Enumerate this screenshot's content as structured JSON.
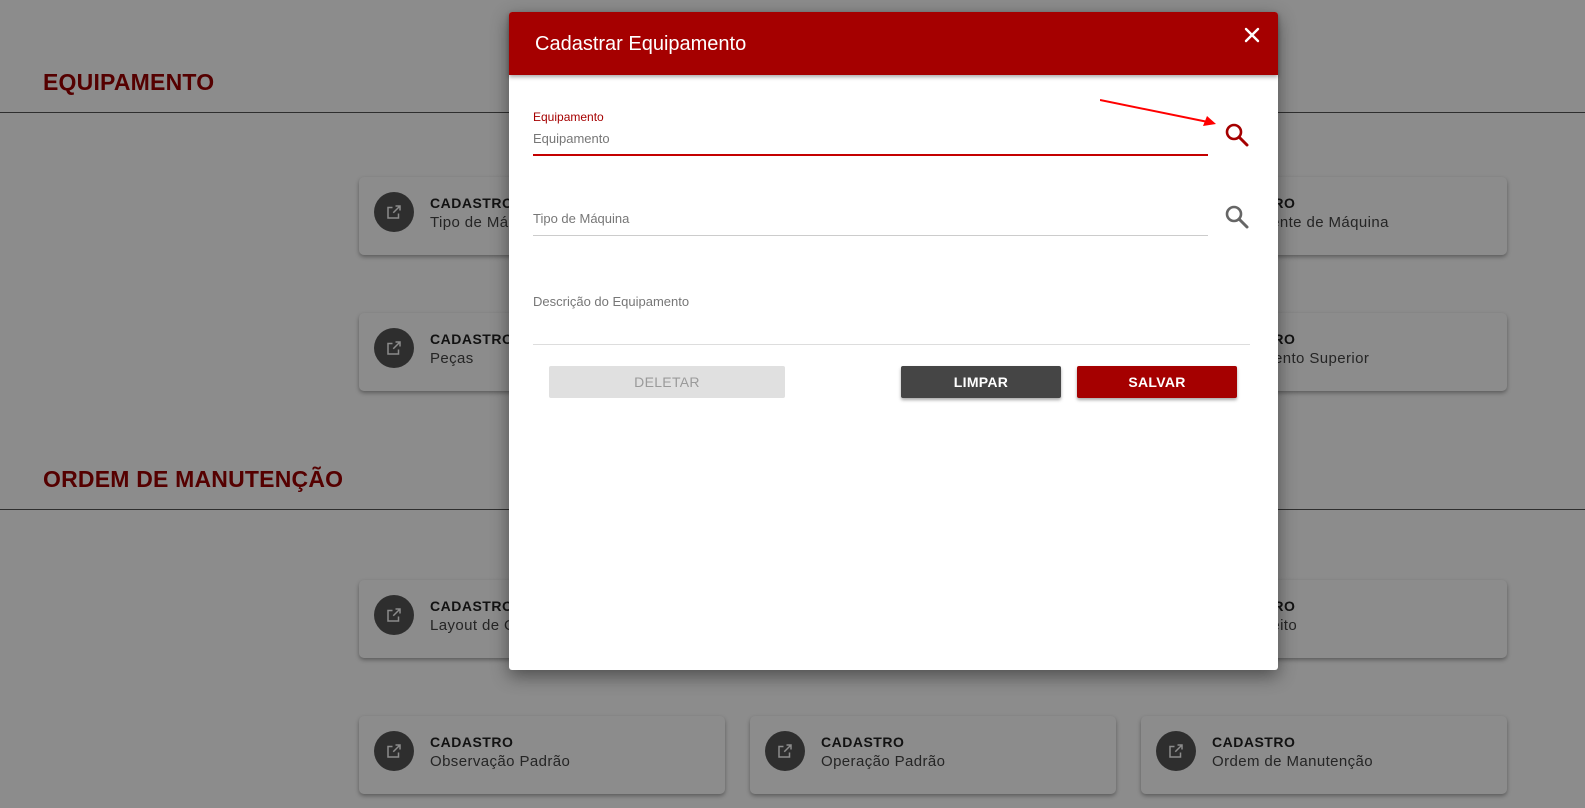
{
  "background": {
    "sections": [
      {
        "title": "EQUIPAMENTO"
      },
      {
        "title": "ORDEM DE MANUTENÇÃO"
      }
    ],
    "cards": [
      {
        "kind": "CADASTRO",
        "name": "Tipo de Máquina"
      },
      {
        "kind": "CADASTRO",
        "name": "Componente de Máquina"
      },
      {
        "kind": "CADASTRO",
        "name": "Peças"
      },
      {
        "kind": "CADASTRO",
        "name": "Equipamento Superior"
      },
      {
        "kind": "CADASTRO",
        "name": "Layout de Ordem"
      },
      {
        "kind": "CADASTRO",
        "name": "Tipo Defeito"
      },
      {
        "kind": "CADASTRO",
        "name": "Observação Padrão"
      },
      {
        "kind": "CADASTRO",
        "name": "Operação Padrão"
      },
      {
        "kind": "CADASTRO",
        "name": "Ordem de Manutenção"
      }
    ],
    "card_icon": "open-in-new-icon"
  },
  "modal": {
    "title": "Cadastrar Equipamento",
    "close_icon": "close-icon",
    "fields": {
      "equipamento": {
        "label": "Equipamento",
        "placeholder": "Equipamento",
        "value": ""
      },
      "tipo_maquina": {
        "placeholder": "Tipo de Máquina"
      },
      "descricao": {
        "placeholder": "Descrição do Equipamento"
      }
    },
    "search_icon": "search-icon",
    "buttons": {
      "delete": "DELETAR",
      "clear": "LIMPAR",
      "save": "SALVAR"
    }
  },
  "colors": {
    "brand": "#a50000",
    "overlay": "rgba(0,0,0,0.45)",
    "annotation": "#ff0000"
  }
}
